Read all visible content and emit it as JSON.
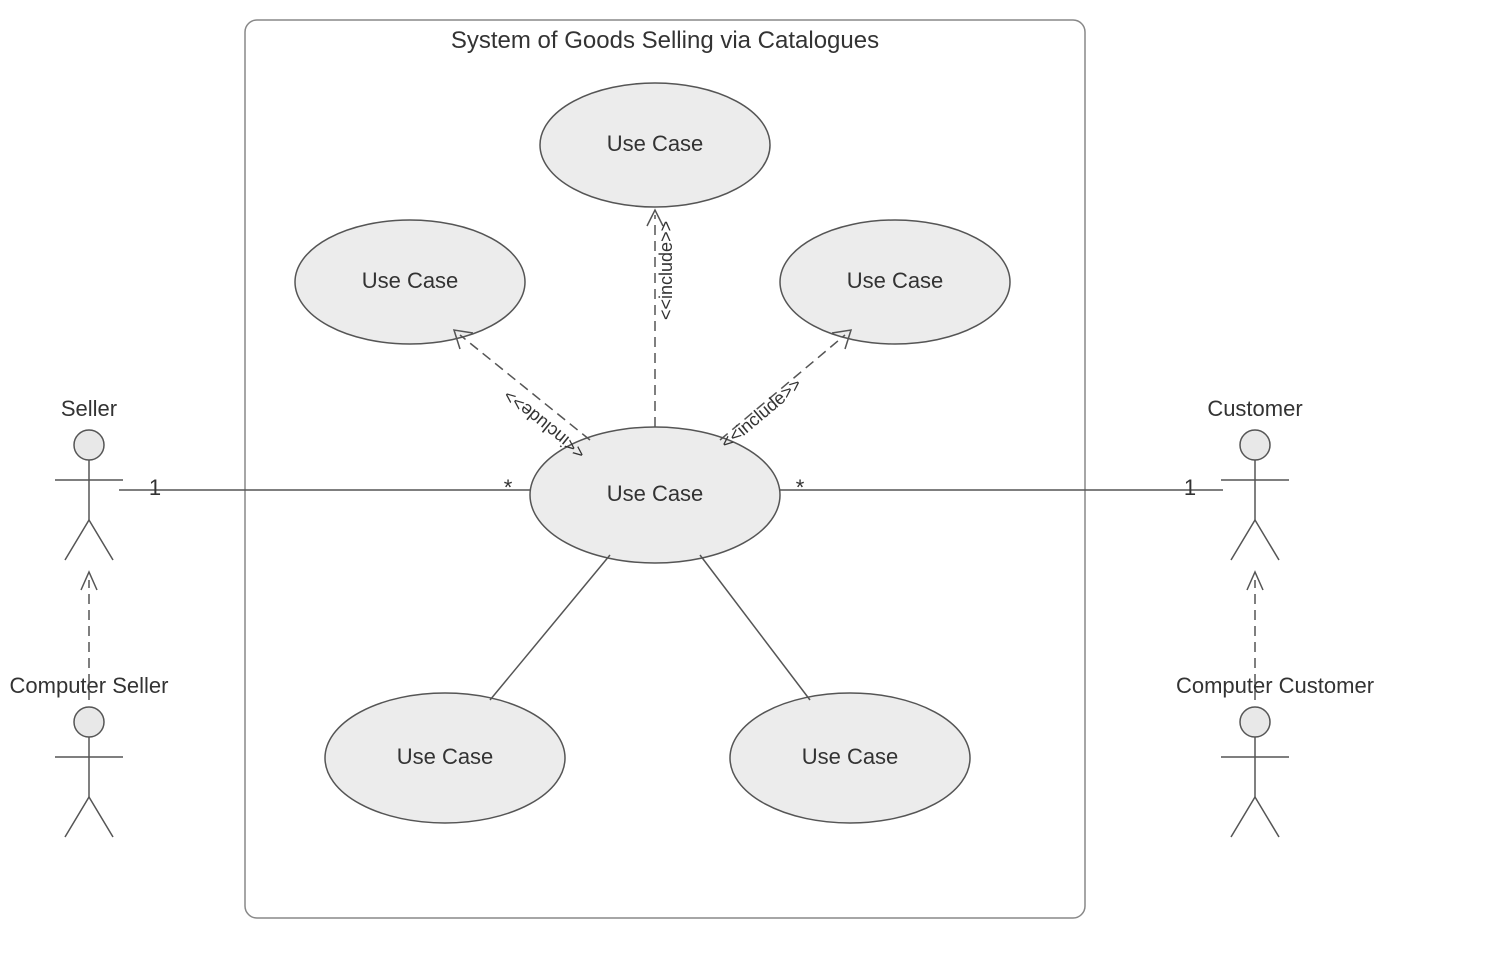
{
  "diagram": {
    "system_title": "System of Goods Selling via Catalogues",
    "actors": {
      "seller": {
        "label": "Seller"
      },
      "computer_seller": {
        "label": "Computer Seller"
      },
      "customer": {
        "label": "Customer"
      },
      "computer_customer": {
        "label": "Computer Customer"
      }
    },
    "usecases": {
      "top": {
        "label": "Use Case"
      },
      "left": {
        "label": "Use Case"
      },
      "right": {
        "label": "Use Case"
      },
      "center": {
        "label": "Use Case"
      },
      "bottom_left": {
        "label": "Use Case"
      },
      "bottom_right": {
        "label": "Use Case"
      }
    },
    "stereotype": {
      "include1": "<<include>>",
      "include2": "<<include>>",
      "include3": "<<include>>"
    },
    "multiplicities": {
      "seller_near": "1",
      "seller_far": "*",
      "customer_near": "1",
      "customer_far": "*"
    }
  }
}
